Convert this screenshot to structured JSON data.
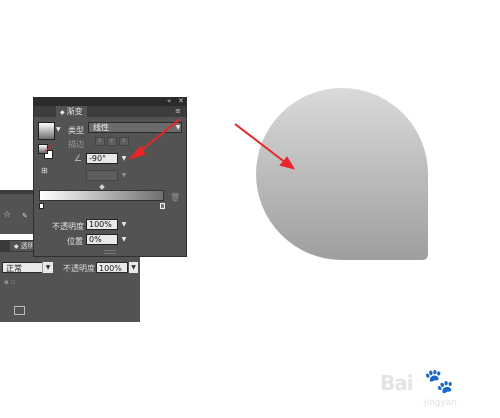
{
  "gradient_panel": {
    "tab_label": "渐变",
    "type_label": "类型",
    "type_value": "线性",
    "stroke_label": "描边",
    "angle_value": "-90°",
    "opacity_label": "不透明度",
    "opacity_value": "100%",
    "position_label": "位置",
    "position_value": "0%",
    "gradient_start_color": "#ffffff",
    "gradient_end_color": "#707070"
  },
  "transparency_panel": {
    "tab_label": "透明度",
    "blend_mode_value": "正常",
    "opacity_label": "不透明度",
    "opacity_value": "100%"
  },
  "canvas_shape": {
    "fill_top_color": "#dadada",
    "fill_bottom_color": "#9e9e9e"
  },
  "annotation": {
    "arrow_color": "#e8262a"
  },
  "watermark": {
    "brand": "Bai",
    "sub": "jingyan"
  }
}
